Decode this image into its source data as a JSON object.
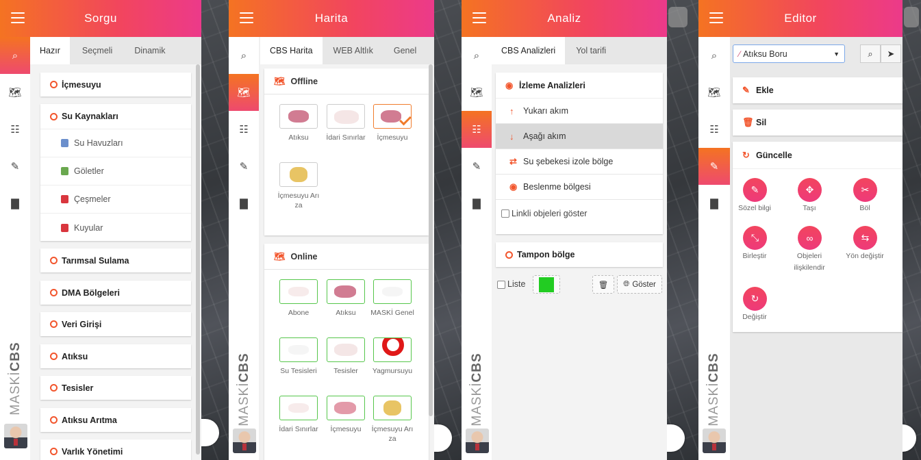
{
  "panel1": {
    "title": "Sorgu",
    "tabs": [
      "Hazır",
      "Seçmeli",
      "Dinamik"
    ],
    "groups": [
      "İçmesuyu",
      "Su Kaynakları",
      "Tarımsal Sulama",
      "DMA Bölgeleri",
      "Veri Girişi",
      "Atıksu",
      "Tesisler",
      "Atıksu Arıtma",
      "Varlık Yönetimi"
    ],
    "subitems": [
      "Su Havuzları",
      "Göletler",
      "Çeşmeler",
      "Kuyular"
    ]
  },
  "panel2": {
    "title": "Harita",
    "tabs": [
      "CBS Harita",
      "WEB Altlık",
      "Genel"
    ],
    "offline_title": "Offline",
    "offline": [
      "Atıksu",
      "İdari Sınırlar",
      "İçmesuyu",
      "İçmesuyu Arıza"
    ],
    "online_title": "Online",
    "online": [
      "Abone",
      "Atıksu",
      "MASKİ Genel",
      "Su Tesisleri",
      "Tesisler",
      "Yagmursuyu",
      "İdari Sınırlar",
      "İçmesuyu",
      "İçmesuyu Arıza"
    ]
  },
  "panel3": {
    "title": "Analiz",
    "tabs": [
      "CBS Analizleri",
      "Yol tarifi"
    ],
    "section_title": "İzleme Analizleri",
    "items": [
      "Yukarı akım",
      "Aşağı akım",
      "Su şebekesi izole bölge",
      "Beslenme bölgesi"
    ],
    "linked_checkbox": "Linkli objeleri göster",
    "buffer_title": "Tampon bölge",
    "list_checkbox": "Liste",
    "show_button": "Göster",
    "swatch_color": "#22cc22"
  },
  "panel4": {
    "title": "Editor",
    "layer_select": "Atıksu Boru",
    "add": "Ekle",
    "delete": "Sil",
    "update": "Güncelle",
    "tools": [
      "Sözel bilgi",
      "Taşı",
      "Böl",
      "Birleştir",
      "Objeleri ilişkilendir",
      "Yön değiştir",
      "Değiştir"
    ]
  },
  "brand": {
    "logo_light": "MASKİ",
    "logo_bold": "CBS"
  },
  "colors": {
    "accent_orange": "#f47322",
    "accent_pink": "#ec3a8a",
    "online_border": "#55c64a"
  }
}
